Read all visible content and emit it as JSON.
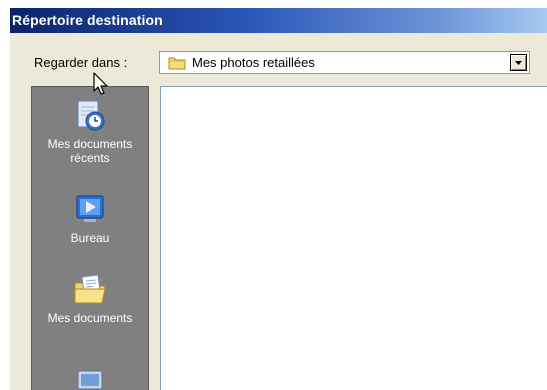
{
  "window": {
    "title": "Répertoire destination"
  },
  "look_in": {
    "label": "Regarder dans :",
    "value": "Mes photos retaillées"
  },
  "places": [
    {
      "label": "Mes documents récents",
      "icon": "recent-documents-icon"
    },
    {
      "label": "Bureau",
      "icon": "desktop-icon"
    },
    {
      "label": "Mes documents",
      "icon": "my-documents-icon"
    },
    {
      "label": "",
      "icon": "my-computer-icon"
    }
  ],
  "colors": {
    "titlebar_start": "#0a246a",
    "titlebar_end": "#a6caf0",
    "places_bar": "#808080",
    "dialog_bg": "#ece9d8"
  }
}
